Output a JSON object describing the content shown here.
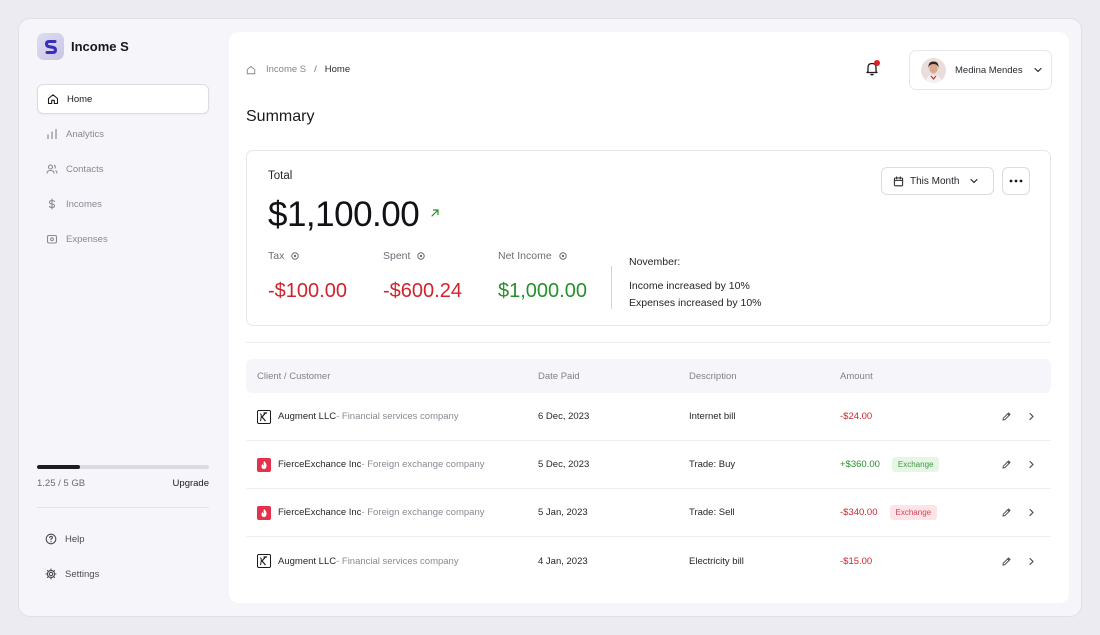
{
  "app": {
    "name": "Income S"
  },
  "sidebar": {
    "items": [
      {
        "label": "Home",
        "icon": "home-icon",
        "active": true
      },
      {
        "label": "Analytics",
        "icon": "bar-chart-icon"
      },
      {
        "label": "Contacts",
        "icon": "users-icon"
      },
      {
        "label": "Incomes",
        "icon": "dollar-icon"
      },
      {
        "label": "Expenses",
        "icon": "wallet-icon"
      }
    ],
    "storage": {
      "used_label": "1.25 / 5 GB",
      "used_fraction": 0.25,
      "upgrade_label": "Upgrade"
    },
    "bottom_items": [
      {
        "label": "Help",
        "icon": "help-icon"
      },
      {
        "label": "Settings",
        "icon": "gear-icon"
      }
    ]
  },
  "header": {
    "breadcrumb": {
      "root": "Income S",
      "separator": "/",
      "current": "Home"
    },
    "user": {
      "name": "Medina Mendes"
    }
  },
  "page": {
    "title": "Summary"
  },
  "summary": {
    "total_label": "Total",
    "total_value": "$1,100.00",
    "period_label": "This Month",
    "metrics": [
      {
        "label": "Tax",
        "value": "-$100.00",
        "tone": "negative"
      },
      {
        "label": "Spent",
        "value": "-$600.24",
        "tone": "negative"
      },
      {
        "label": "Net Income",
        "value": "$1,000.00",
        "tone": "positive"
      }
    ],
    "insight": {
      "month": "November:",
      "line1": "Income increased by 10%",
      "line2": "Expenses increased by 10%"
    }
  },
  "table": {
    "headers": [
      "Client / Customer",
      "Date Paid",
      "Description",
      "Amount"
    ],
    "rows": [
      {
        "client": "Augment LLC",
        "client_desc": " - Financial services company",
        "logo": "x",
        "date": "6 Dec, 2023",
        "description": "Internet bill",
        "amount": "-$24.00",
        "tone": "negative",
        "tag": ""
      },
      {
        "client": "FierceExchance Inc",
        "client_desc": " - Foreign exchange company",
        "logo": "fire",
        "date": "5 Dec, 2023",
        "description": "Trade: Buy",
        "amount": "+$360.00",
        "tone": "positive",
        "tag": "Exchange"
      },
      {
        "client": "FierceExchance Inc",
        "client_desc": " - Foreign exchange company",
        "logo": "fire",
        "date": "5 Jan, 2023",
        "description": "Trade: Sell",
        "amount": "-$340.00",
        "tone": "negative",
        "tag": "Exchange"
      },
      {
        "client": "Augment LLC",
        "client_desc": " - Financial services company",
        "logo": "x",
        "date": "4 Jan, 2023",
        "description": "Electricity bill",
        "amount": "-$15.00",
        "tone": "negative",
        "tag": ""
      }
    ]
  },
  "colors": {
    "negative": "#d0232d",
    "positive": "#24912a",
    "notification_dot": "#e0211d"
  }
}
